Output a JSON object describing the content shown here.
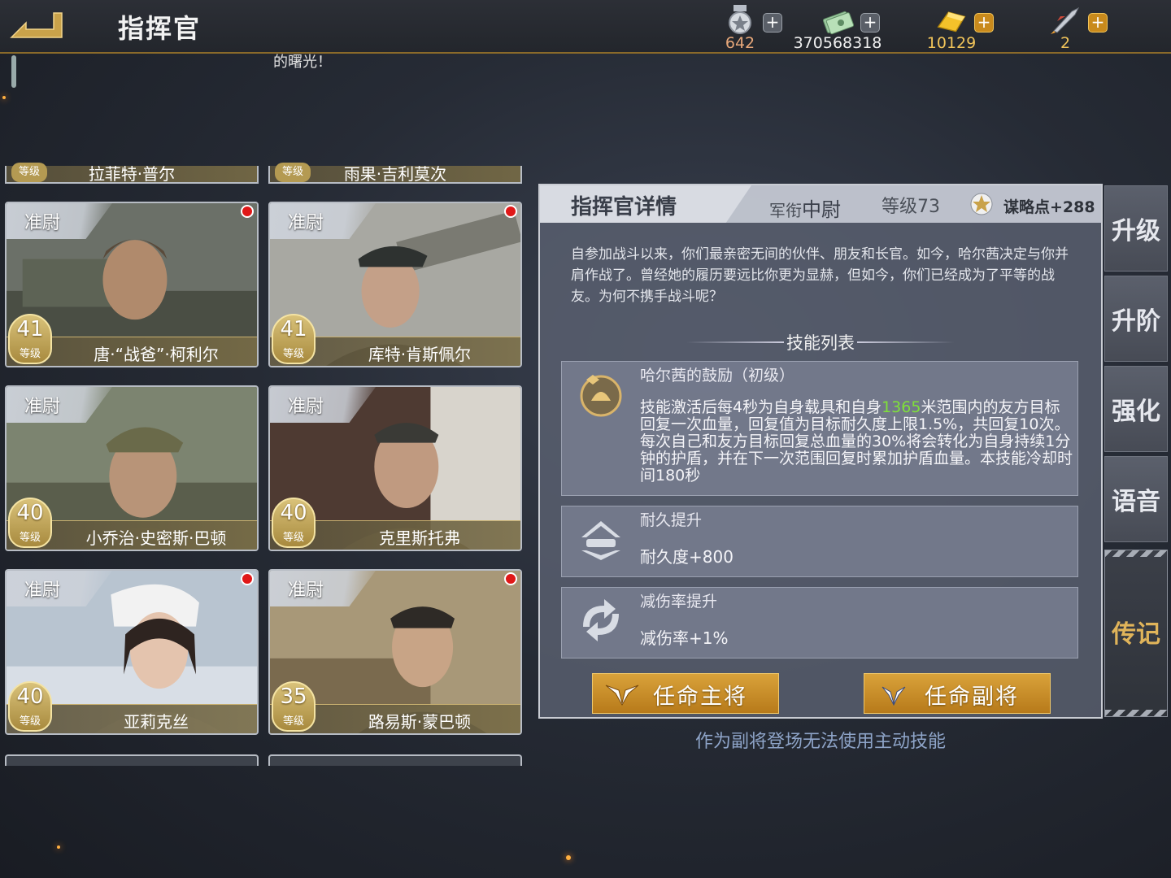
{
  "header": {
    "title": "指挥官",
    "resources": [
      {
        "icon": "medal-icon",
        "value": "642"
      },
      {
        "icon": "cash-icon",
        "value": "370568318"
      },
      {
        "icon": "gold-icon",
        "value": "10129"
      },
      {
        "icon": "rocket-icon",
        "value": "2"
      }
    ]
  },
  "notice": "的曙光！",
  "partial_cards": [
    {
      "level_label": "等级",
      "name": "拉菲特·普尔"
    },
    {
      "level_label": "等级",
      "name": "雨果·吉利莫次"
    }
  ],
  "commanders": [
    {
      "rank": "准尉",
      "level": "41",
      "level_label": "等级",
      "name": "唐·“战爸”·柯利尔",
      "new": true
    },
    {
      "rank": "准尉",
      "level": "41",
      "level_label": "等级",
      "name": "库特·肯斯佩尔",
      "new": true
    },
    {
      "rank": "准尉",
      "level": "40",
      "level_label": "等级",
      "name": "小乔治·史密斯·巴顿",
      "new": false
    },
    {
      "rank": "准尉",
      "level": "40",
      "level_label": "等级",
      "name": "克里斯托弗",
      "new": false
    },
    {
      "rank": "准尉",
      "level": "40",
      "level_label": "等级",
      "name": "亚莉克丝",
      "new": true
    },
    {
      "rank": "准尉",
      "level": "35",
      "level_label": "等级",
      "name": "路易斯·蒙巴顿",
      "new": true
    }
  ],
  "detail": {
    "title": "指挥官详情",
    "rank_label": "军衔",
    "rank_value": "中尉",
    "level_text": "等级73",
    "strategy_text": "谋略点+288",
    "description": "自参加战斗以来，你们最亲密无间的伙伴、朋友和长官。如今，哈尔茜决定与你并肩作战了。曾经她的履历要远比你更为显赫，但如今，你们已经成为了平等的战友。为何不携手战斗呢？",
    "skill_list_title": "技能列表",
    "skills": [
      {
        "icon": "encourage-icon",
        "name": "哈尔茜的鼓励（初级）",
        "desc_before": "技能激活后每4秒为自身载具和自身",
        "desc_highlight": "1365",
        "desc_after": "米范围内的友方目标回复一次血量，回复值为目标耐久度上限1.5%，共回复10次。每次自己和友方目标回复总血量的30%将会转化为自身持续1分钟的护盾，并在下一次范围回复时累加护盾血量。本技能冷却时间180秒"
      },
      {
        "icon": "durability-icon",
        "name": "耐久提升",
        "value": "耐久度+800"
      },
      {
        "icon": "damage-reduction-icon",
        "name": "减伤率提升",
        "value": "减伤率+1%"
      }
    ],
    "btn_main": "任命主将",
    "btn_sub": "任命副将"
  },
  "hint": "作为副将登场无法使用主动技能",
  "side_tabs": [
    "升级",
    "升阶",
    "强化",
    "语音",
    "传记"
  ],
  "active_tab": "传记",
  "colors": {
    "accent_gold": "#d9a23a",
    "highlight_green": "#7fe03a",
    "hint_blue": "#8ea4c8",
    "new_dot": "#e01818"
  }
}
